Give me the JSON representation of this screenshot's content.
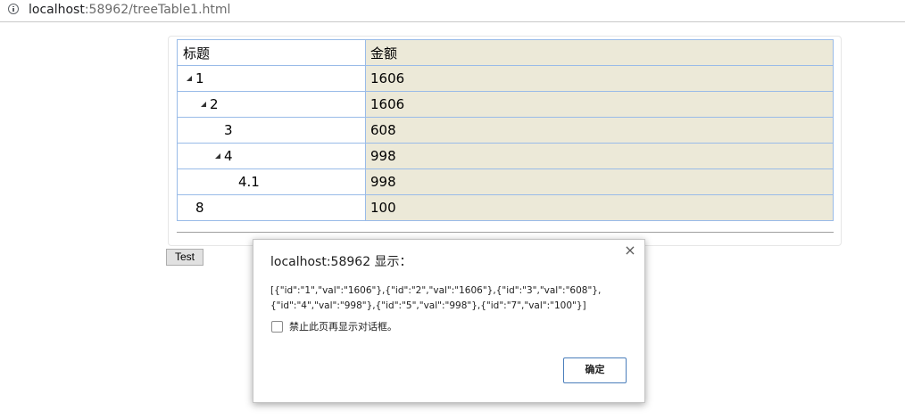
{
  "browser": {
    "url_host": "localhost",
    "url_rest": ":58962/treeTable1.html"
  },
  "table": {
    "headers": [
      "标题",
      "金额"
    ],
    "rows": [
      {
        "title": "1",
        "amount": "1606",
        "level": 0,
        "expanded": true
      },
      {
        "title": "2",
        "amount": "1606",
        "level": 1,
        "expanded": true
      },
      {
        "title": "3",
        "amount": "608",
        "level": 2,
        "expanded": false
      },
      {
        "title": "4",
        "amount": "998",
        "level": 2,
        "expanded": true
      },
      {
        "title": "4.1",
        "amount": "998",
        "level": 3,
        "expanded": false
      },
      {
        "title": "8",
        "amount": "100",
        "level": 0,
        "expanded": false
      }
    ],
    "amount_column_color": "#ece9d8",
    "border_color": "#99bbe8"
  },
  "test_button": {
    "label": "Test"
  },
  "dialog": {
    "title": "localhost:58962 显示：",
    "message_line1": "[{\"id\":\"1\",\"val\":\"1606\"},{\"id\":\"2\",\"val\":\"1606\"},{\"id\":\"3\",\"val\":\"608\"},",
    "message_line2": "{\"id\":\"4\",\"val\":\"998\"},{\"id\":\"5\",\"val\":\"998\"},{\"id\":\"7\",\"val\":\"100\"}]",
    "checkbox_label": "禁止此页再显示对话框。",
    "checkbox_checked": false,
    "ok_label": "确定",
    "close_icon": "close-icon",
    "ok_border_color": "#4a7ebb"
  }
}
